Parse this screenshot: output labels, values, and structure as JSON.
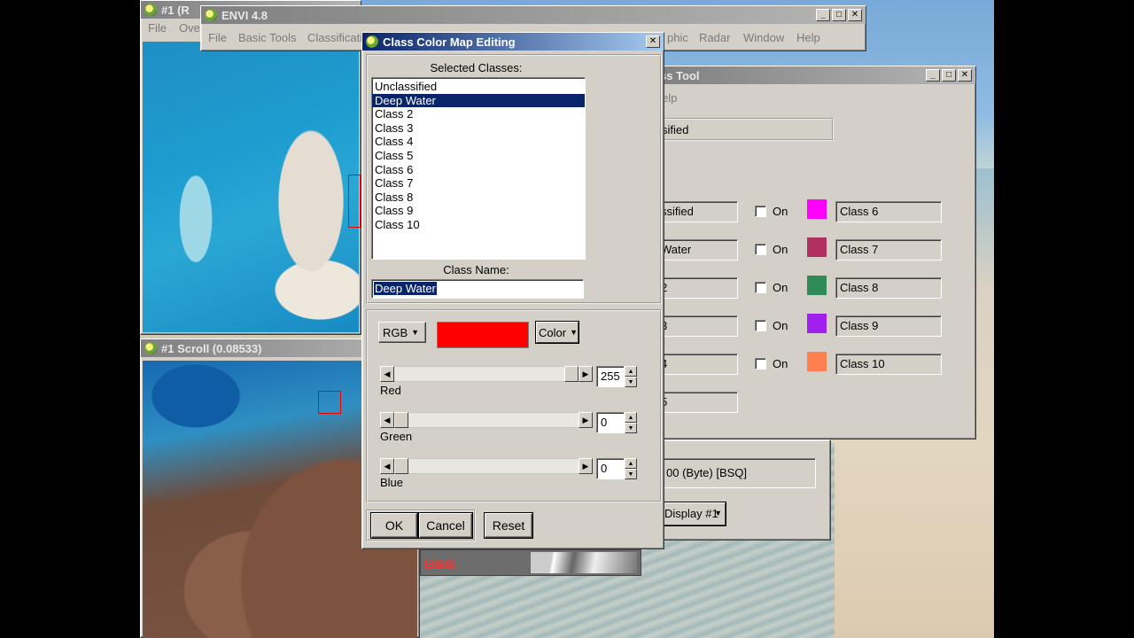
{
  "image_window": {
    "title": "#1 (R",
    "menu": [
      "File",
      "Ove"
    ]
  },
  "scroll_window": {
    "title": "#1 Scroll (0.08533)"
  },
  "envi_window": {
    "title": "ENVI 4.8",
    "menu": [
      "File",
      "Basic Tools",
      "Classificati",
      "phic",
      "Radar",
      "Window",
      "Help"
    ]
  },
  "class_tool_window": {
    "title": "ss Tool",
    "menu_help": "elp",
    "active_class": "sified",
    "rows_left": [
      {
        "label": "ssified"
      },
      {
        "label": "Water"
      },
      {
        "label": "2"
      },
      {
        "label": "3"
      },
      {
        "label": "4"
      },
      {
        "label": "5"
      }
    ],
    "on_label": "On",
    "rows_right": [
      {
        "label": "Class 6",
        "color": "#ff00ff"
      },
      {
        "label": "Class 7",
        "color": "#b03060"
      },
      {
        "label": "Class 8",
        "color": "#2e8b57"
      },
      {
        "label": "Class 9",
        "color": "#a020f0"
      },
      {
        "label": "Class 10",
        "color": "#ff7f50"
      }
    ],
    "file_info": "00 (Byte) [BSQ]",
    "display_select": "Display #1"
  },
  "dialog": {
    "title": "Class Color Map Editing",
    "selected_classes_label": "Selected Classes:",
    "classes": [
      "Unclassified",
      "Deep Water",
      "Class 2",
      "Class 3",
      "Class 4",
      "Class 5",
      "Class 6",
      "Class 7",
      "Class 8",
      "Class 9",
      "Class 10"
    ],
    "selected_index": 1,
    "class_name_label": "Class Name:",
    "class_name_value": "Deep Water",
    "color_model": "RGB",
    "color_button": "Color",
    "current_color": "#ff0000",
    "sliders": [
      {
        "label": "Red",
        "value": "255",
        "fraction": 1.0
      },
      {
        "label": "Green",
        "value": "0",
        "fraction": 0.0
      },
      {
        "label": "Blue",
        "value": "0",
        "fraction": 0.0
      }
    ],
    "buttons": {
      "ok": "OK",
      "cancel": "Cancel",
      "reset": "Reset"
    }
  }
}
